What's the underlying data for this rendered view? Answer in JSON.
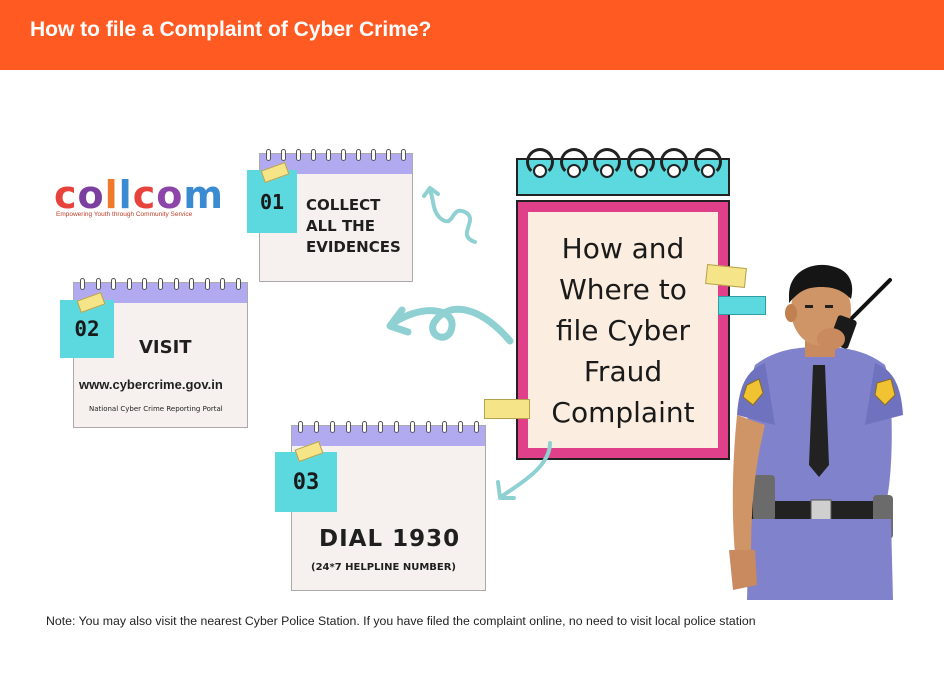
{
  "header": {
    "title": "How to file a Complaint of Cyber Crime?"
  },
  "logo": {
    "wordmark": "collcom",
    "tagline": "Empowering Youth through Community Service"
  },
  "steps": [
    {
      "number": "01",
      "lines": [
        "COLLECT",
        "ALL THE",
        "EVIDENCES"
      ]
    },
    {
      "number": "02",
      "heading": "VISIT",
      "url": "www.cybercrime.gov.in",
      "caption": "National Cyber Crime Reporting Portal"
    },
    {
      "number": "03",
      "heading": "DIAL 1930",
      "caption": "(24*7 HELPLINE NUMBER)"
    }
  ],
  "calendar": {
    "lines": [
      "How and",
      "Where to",
      "file Cyber",
      "Fraud",
      "Complaint"
    ]
  },
  "note": "Note: You may also visit the nearest Cyber Police Station. If you have filed the complaint online, no need to visit local police station",
  "colors": {
    "header": "#ff5a22",
    "card_top": "#b2aaf0",
    "number_box": "#5cd9de",
    "calendar_frame": "#e03f8a",
    "arrow": "#8fd1d3"
  },
  "icons": [
    "police-officer-illustration",
    "curved-arrow",
    "spiral-arrow",
    "calendar-rings"
  ]
}
